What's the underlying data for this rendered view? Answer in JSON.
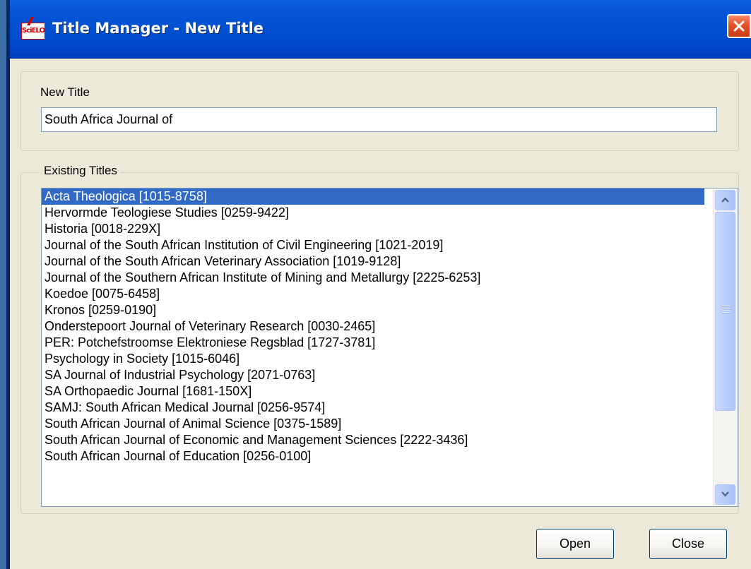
{
  "window": {
    "title": "Title Manager - New Title",
    "app_icon_text": "SciELO"
  },
  "new_title": {
    "label": "New Title",
    "value": "South Africa Journal of"
  },
  "existing_titles": {
    "label": "Existing Titles",
    "selected_index": 0,
    "items": [
      "Acta Theologica [1015-8758]",
      "Hervormde Teologiese Studies [0259-9422]",
      "Historia [0018-229X]",
      "Journal of the South African Institution of Civil Engineering [1021-2019]",
      "Journal of the South African Veterinary Association  [1019-9128]",
      "Journal of the Southern African Institute of Mining and Metallurgy [2225-6253]",
      "Koedoe [0075-6458]",
      "Kronos [0259-0190]",
      "Onderstepoort Journal of Veterinary Research [0030-2465]",
      "PER: Potchefstroomse Elektroniese Regsblad [1727-3781]",
      "Psychology in Society [1015-6046]",
      "SA Journal of Industrial Psychology [2071-0763]",
      "SA Orthopaedic Journal [1681-150X]",
      "SAMJ: South African Medical Journal [0256-9574]",
      "South African Journal of Animal Science [0375-1589]",
      "South African Journal of Economic and Management Sciences  [2222-3436]",
      "South African Journal of Education [0256-0100]"
    ]
  },
  "buttons": {
    "open": "Open",
    "close": "Close"
  },
  "colors": {
    "titlebar": "#0050d2",
    "selection": "#316ac5",
    "dialog_bg": "#ece9d8",
    "close_button": "#e3512a"
  }
}
